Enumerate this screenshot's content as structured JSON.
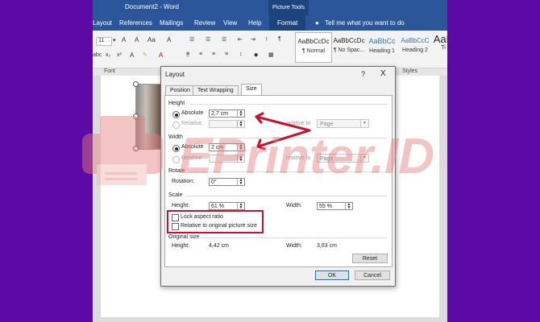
{
  "app": {
    "doc_title": "Document2 - Word",
    "picture_tools": "Picture Tools",
    "tabs": [
      "Layout",
      "References",
      "Mailings",
      "Review",
      "View",
      "Help",
      "Format"
    ],
    "tell_me": "Tell me what you want to do",
    "font_size": "11",
    "font_group_label": "Font",
    "styles_group_label": "Styles",
    "styles": [
      {
        "sample": "AaBbCcDc",
        "name": "¶ Normal"
      },
      {
        "sample": "AaBbCcDc",
        "name": "¶ No Spac..."
      },
      {
        "sample": "AaBbCc",
        "name": "Heading 1"
      },
      {
        "sample": "AaBbCcC",
        "name": "Heading 2"
      },
      {
        "sample": "AaB",
        "name": "Ti"
      }
    ]
  },
  "dialog": {
    "title": "Layout",
    "help": "?",
    "close": "X",
    "tabs": [
      "Position",
      "Text Wrapping",
      "Size"
    ],
    "height": {
      "section": "Height",
      "absolute_label": "Absolute",
      "absolute_value": "2,7 cm",
      "relative_label": "Relative",
      "relative_to_label": "relative to",
      "relative_to_value": "Page"
    },
    "width": {
      "section": "Width",
      "absolute_label": "Absolute",
      "absolute_value": "2 cm",
      "relative_label": "Relative",
      "relative_to_label": "relative to",
      "relative_to_value": "Page"
    },
    "rotate": {
      "section": "Rotate",
      "rotation_label": "Rotation:",
      "rotation_value": "0°"
    },
    "scale": {
      "section": "Scale",
      "height_label": "Height:",
      "height_value": "61 %",
      "width_label": "Width:",
      "width_value": "55 %",
      "lock_aspect": "Lock aspect ratio",
      "relative_original": "Relative to original picture size"
    },
    "original": {
      "section": "Original size",
      "height_label": "Height:",
      "height_value": "4,42 cm",
      "width_label": "Width:",
      "width_value": "3,63 cm"
    },
    "reset": "Reset",
    "ok": "OK",
    "cancel": "Cancel"
  },
  "watermark": "EPrinter.ID",
  "colors": {
    "background": "#5b0aa6",
    "word_blue": "#2b579a",
    "annotation_red": "#c8102e"
  }
}
